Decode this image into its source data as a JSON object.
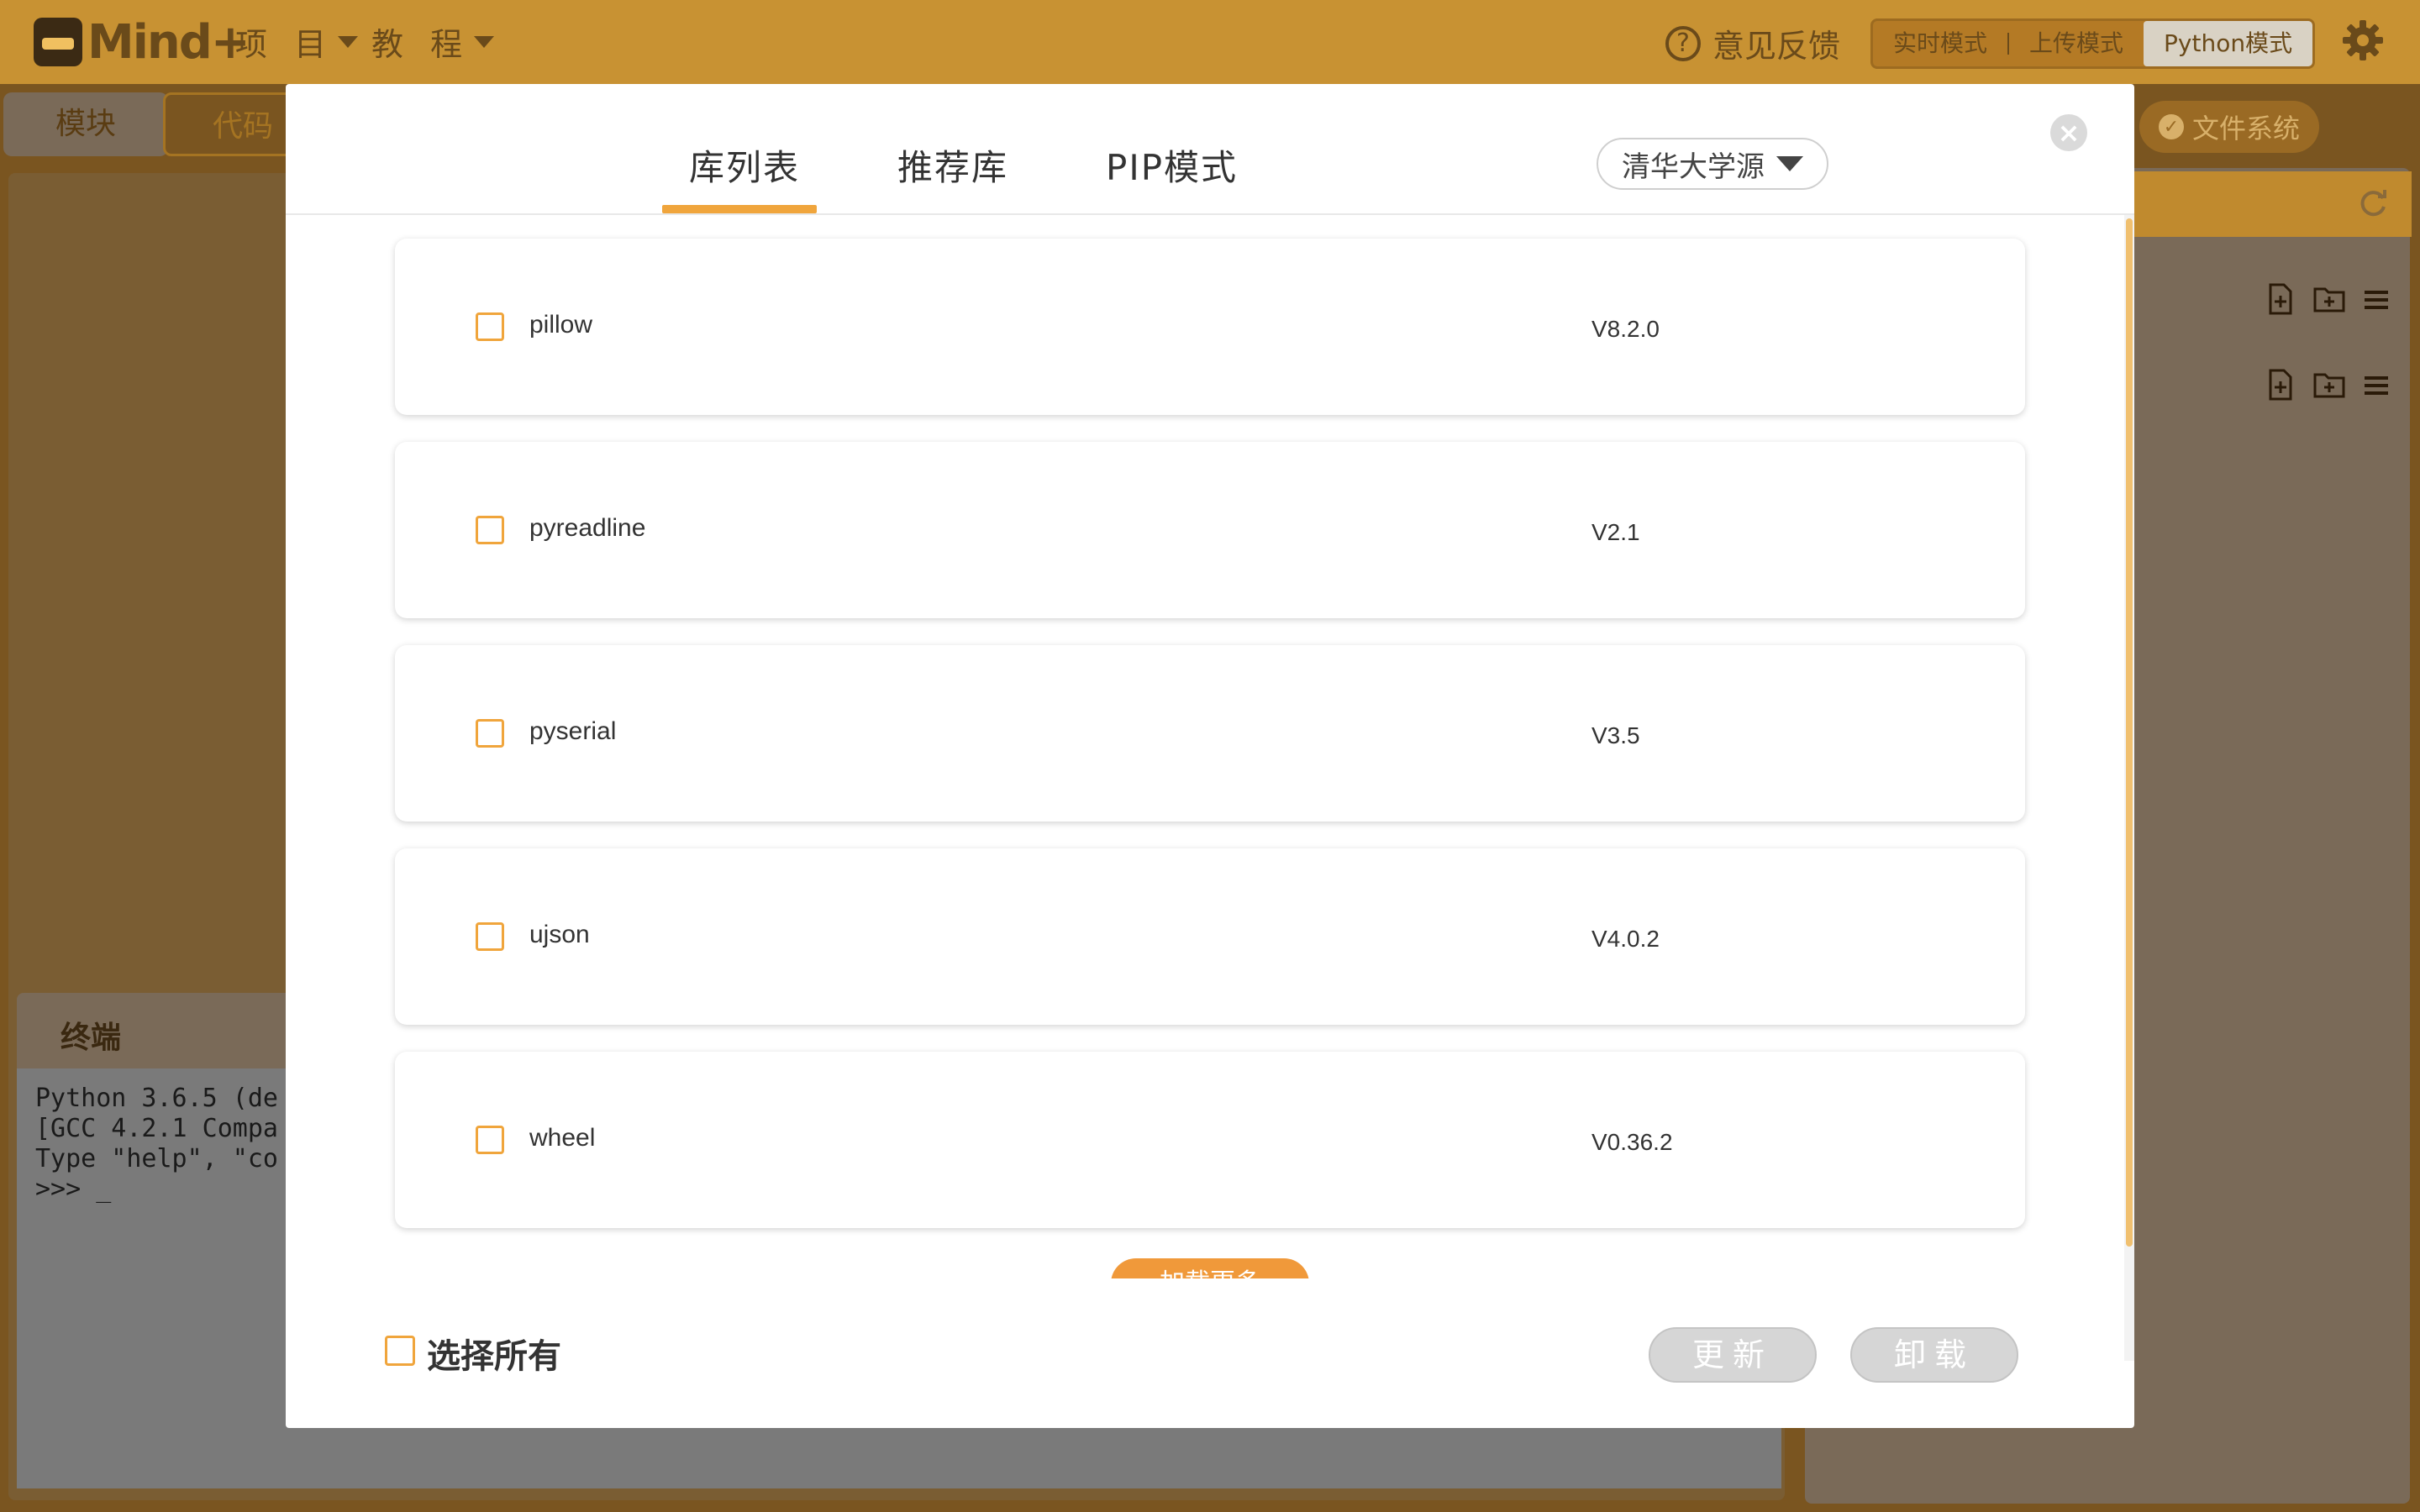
{
  "app": {
    "logo_text": "Mind+",
    "menu_project": "项 目",
    "menu_tutorial": "教 程",
    "feedback": "意见反馈",
    "modes": [
      "实时模式",
      "上传模式",
      "Python模式"
    ],
    "active_mode": "Python模式"
  },
  "workspace": {
    "tab_blocks": "模块",
    "tab_code": "代码",
    "file_system": "文件系统",
    "terminal_title": "终端",
    "terminal_lines": [
      "Python 3.6.5 (de",
      "[GCC 4.2.1 Compa",
      "Type \"help\", \"co",
      ">>> _"
    ]
  },
  "modal": {
    "tabs": [
      "库列表",
      "推荐库",
      "PIP模式"
    ],
    "active_tab": "库列表",
    "source": "清华大学源",
    "close_symbol": "×",
    "packages": [
      {
        "name": "pillow",
        "version": "V8.2.0"
      },
      {
        "name": "pyreadline",
        "version": "V2.1"
      },
      {
        "name": "pyserial",
        "version": "V3.5"
      },
      {
        "name": "ujson",
        "version": "V4.0.2"
      },
      {
        "name": "wheel",
        "version": "V0.36.2"
      }
    ],
    "load_more": "加载更多",
    "select_all": "选择所有",
    "update_button": "更新",
    "uninstall_button": "卸载"
  },
  "colors": {
    "accent": "#f0a53c",
    "topbar": "#c89233",
    "overlay": "#7a5520"
  }
}
